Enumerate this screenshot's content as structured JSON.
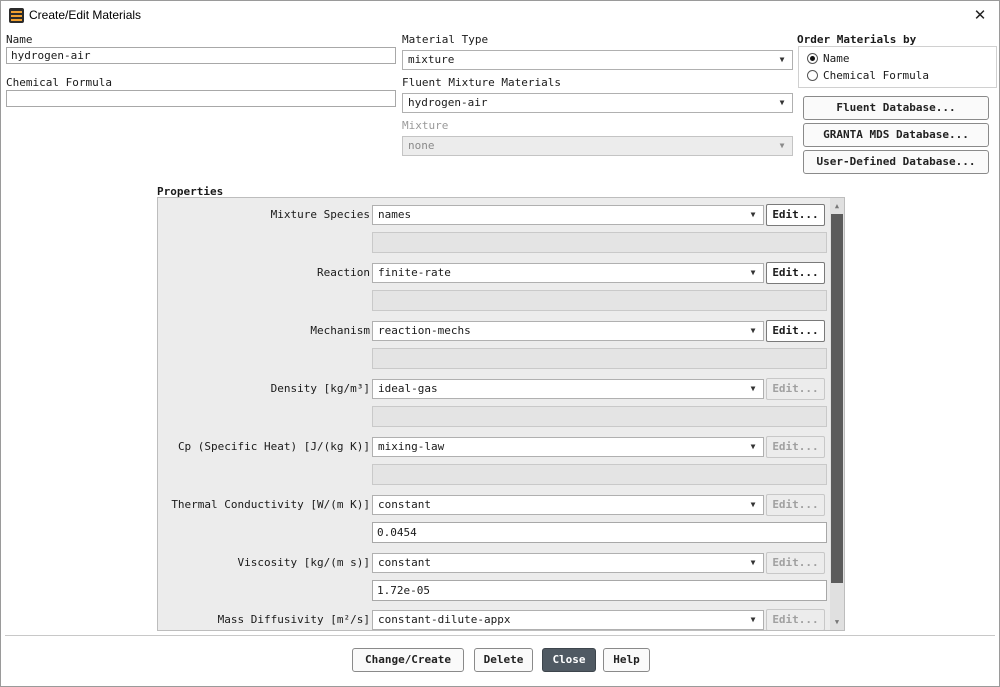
{
  "window": {
    "title": "Create/Edit Materials",
    "close_glyph": "✕"
  },
  "name_field": {
    "label": "Name",
    "value": "hydrogen-air"
  },
  "formula_field": {
    "label": "Chemical Formula",
    "value": ""
  },
  "material_type": {
    "label": "Material Type",
    "value": "mixture"
  },
  "fluent_mixture": {
    "label": "Fluent Mixture Materials",
    "value": "hydrogen-air"
  },
  "mixture": {
    "label": "Mixture",
    "value": "none"
  },
  "order": {
    "label": "Order Materials by",
    "options": [
      {
        "label": "Name",
        "selected": true
      },
      {
        "label": "Chemical Formula",
        "selected": false
      }
    ]
  },
  "databases": {
    "fluent": "Fluent Database...",
    "granta": "GRANTA MDS Database...",
    "user": "User-Defined Database..."
  },
  "properties": {
    "label": "Properties",
    "edit_label": "Edit...",
    "rows": [
      {
        "label": "Mixture Species",
        "value": "names",
        "edit_enabled": true,
        "sub": ""
      },
      {
        "label": "Reaction",
        "value": "finite-rate",
        "edit_enabled": true,
        "sub": ""
      },
      {
        "label": "Mechanism",
        "value": "reaction-mechs",
        "edit_enabled": true,
        "sub": ""
      },
      {
        "label": "Density [kg/m³]",
        "value": "ideal-gas",
        "edit_enabled": false,
        "sub": ""
      },
      {
        "label": "Cp (Specific Heat) [J/(kg K)]",
        "value": "mixing-law",
        "edit_enabled": false,
        "sub": ""
      },
      {
        "label": "Thermal Conductivity [W/(m K)]",
        "value": "constant",
        "edit_enabled": false,
        "sub": "0.0454"
      },
      {
        "label": "Viscosity [kg/(m s)]",
        "value": "constant",
        "edit_enabled": false,
        "sub": "1.72e-05"
      },
      {
        "label": "Mass Diffusivity [m²/s]",
        "value": "constant-dilute-appx",
        "edit_enabled": false,
        "sub": ""
      }
    ]
  },
  "buttons": {
    "change_create": "Change/Create",
    "delete": "Delete",
    "close": "Close",
    "help": "Help"
  }
}
